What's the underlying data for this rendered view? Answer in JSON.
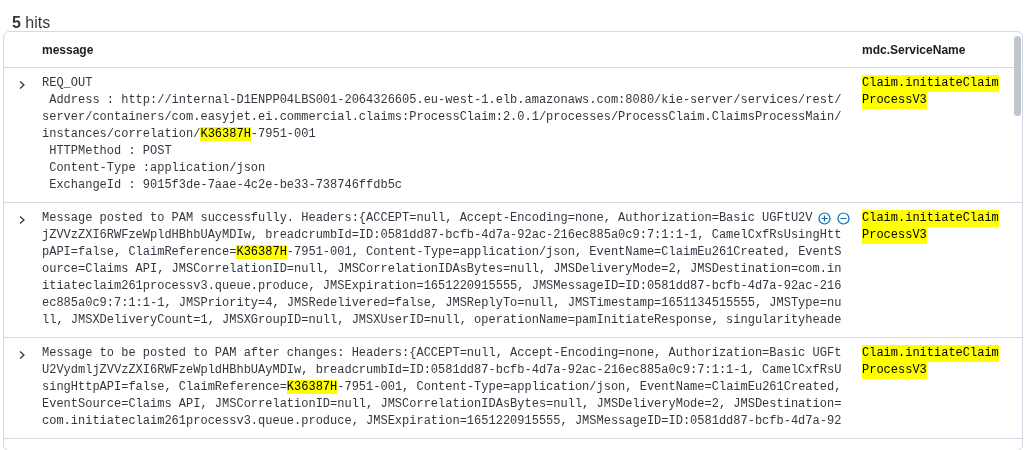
{
  "hits": {
    "count_text": "**5** hits"
  },
  "table": {
    "columns": [
      {
        "label": "message"
      },
      {
        "label": "mdc.ServiceName"
      }
    ],
    "rows": [
      {
        "expanded": false,
        "hover_actions": false,
        "message_lines": [
          "REQ_OUT",
          " Address : http://internal-D1ENPP04LBS001-2064326605.eu-west-1.elb.amazonaws.com:8080/kie-server/services/rest/",
          "server/containers/com.easyjet.ei.commercial.claims:ProcessClaim:2.0.1/processes/ProcessClaim.ClaimsProcessMain/",
          [
            {
              "text": "instances/correlation/",
              "highlight": false
            },
            {
              "text": "K36387H",
              "highlight": true
            },
            {
              "text": "-7951-001",
              "highlight": false
            }
          ],
          " HTTPMethod : POST",
          " Content-Type :application/json",
          " ExchangeId : 9015f3de-7aae-4c2e-be33-738746ffdb5c"
        ],
        "service_lines": [
          {
            "text": "Claim.initiateClaim",
            "highlight": true
          },
          {
            "text": "ProcessV3",
            "highlight": true
          }
        ]
      },
      {
        "expanded": false,
        "hover_actions": true,
        "message_lines": [
          "Message posted to PAM successfully. Headers:{ACCEPT=null, Accept-Encoding=none, Authorization=Basic UGFtU2V",
          "jZVVzZXI6RWFzeWpldHBhbUAyMDIw, breadcrumbId=ID:0581dd87-bcfb-4d7a-92ac-216ec885a0c9:7:1:1-1, CamelCxfRsUsingHtt",
          [
            {
              "text": "pAPI=false, ClaimReference=",
              "highlight": false
            },
            {
              "text": "K36387H",
              "highlight": true
            },
            {
              "text": "-7951-001, Content-Type=application/json, EventName=ClaimEu261Created, EventS",
              "highlight": false
            }
          ],
          "ource=Claims API, JMSCorrelationID=null, JMSCorrelationIDAsBytes=null, JMSDeliveryMode=2, JMSDestination=com.in",
          "itiateclaim261processv3.queue.produce, JMSExpiration=1651220915555, JMSMessageID=ID:0581dd87-bcfb-4d7a-92ac-216",
          "ec885a0c9:7:1:1-1, JMSPriority=4, JMSRedelivered=false, JMSReplyTo=null, JMSTimestamp=1651134515555, JMSType=nu",
          "ll, JMSXDeliveryCount=1, JMSXGroupID=null, JMSXUserID=null, operationName=pamInitiateResponse, singularityheade"
        ],
        "service_lines": [
          {
            "text": "Claim.initiateClaim",
            "highlight": true
          },
          {
            "text": "ProcessV3",
            "highlight": true
          }
        ]
      },
      {
        "expanded": false,
        "hover_actions": false,
        "message_lines": [
          "Message to be posted to PAM after changes: Headers:{ACCEPT=null, Accept-Encoding=none, Authorization=Basic UGFt",
          "U2VydmljZVVzZXI6RWFzeWpldHBhbUAyMDIw, breadcrumbId=ID:0581dd87-bcfb-4d7a-92ac-216ec885a0c9:7:1:1-1, CamelCxfRsU",
          [
            {
              "text": "singHttpAPI=false, ClaimReference=",
              "highlight": false
            },
            {
              "text": "K36387H",
              "highlight": true
            },
            {
              "text": "-7951-001, Content-Type=application/json, EventName=ClaimEu261Created,",
              "highlight": false
            }
          ],
          "EventSource=Claims API, JMSCorrelationID=null, JMSCorrelationIDAsBytes=null, JMSDeliveryMode=2, JMSDestination=",
          "com.initiateclaim261processv3.queue.produce, JMSExpiration=1651220915555, JMSMessageID=ID:0581dd87-bcfb-4d7a-92"
        ],
        "service_lines": [
          {
            "text": "Claim.initiateClaim",
            "highlight": true
          },
          {
            "text": "ProcessV3",
            "highlight": true
          }
        ]
      }
    ]
  }
}
